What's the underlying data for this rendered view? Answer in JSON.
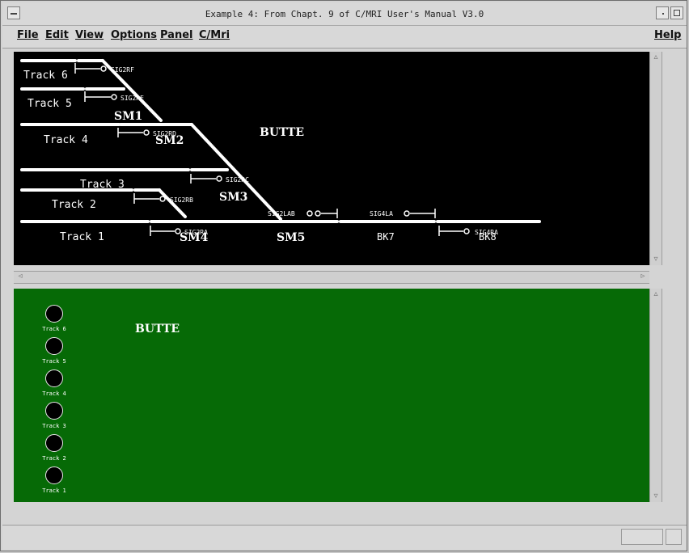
{
  "window": {
    "title": "Example 4: From Chapt. 9 of C/MRI User's Manual V3.0"
  },
  "menu": {
    "file": "File",
    "edit": "Edit",
    "view": "View",
    "options": "Options",
    "panel": "Panel",
    "cmri": "C/Mri",
    "help": "Help"
  },
  "layout": {
    "station": "BUTTE",
    "tracks": [
      {
        "label": "Track 6",
        "signal": "SIG2RF"
      },
      {
        "label": "Track 5",
        "signal": "SIG2RE"
      },
      {
        "label": "Track 4",
        "signal": "SIG2RD"
      },
      {
        "label": "Track 3",
        "signal": "SIG2RC"
      },
      {
        "label": "Track 2",
        "signal": "SIG2RB"
      },
      {
        "label": "Track 1",
        "signal": "SIG2RA"
      }
    ],
    "switch_machines": [
      "SM1",
      "SM2",
      "SM3",
      "SM4",
      "SM5"
    ],
    "blocks": [
      "BK7",
      "BK8"
    ],
    "other_signals": [
      "SIG2LAB",
      "SIG4LA",
      "SIG4RA"
    ]
  },
  "control_panel": {
    "station": "BUTTE",
    "indicators": [
      "Track 6",
      "Track 5",
      "Track 4",
      "Track 3",
      "Track 2",
      "Track 1"
    ]
  },
  "colors": {
    "top_panel_bg": "#000000",
    "bottom_panel_bg": "#066a06",
    "track": "#ffffff"
  }
}
